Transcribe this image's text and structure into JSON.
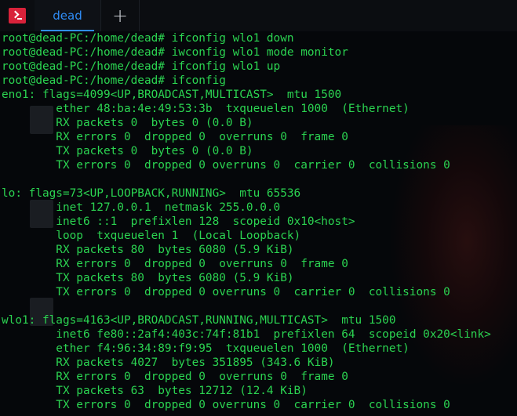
{
  "titlebar": {
    "app_icon": "terminal-icon",
    "tab_label": "dead",
    "add_tab_icon": "plus-icon"
  },
  "colors": {
    "background": "#05070a",
    "text": "#2bd451",
    "tab_accent": "#2f8df7",
    "app_icon": "#d9223a"
  },
  "terminal": {
    "lines": [
      "root@dead-PC:/home/dead# ifconfig wlo1 down",
      "root@dead-PC:/home/dead# iwconfig wlo1 mode monitor",
      "root@dead-PC:/home/dead# ifconfig wlo1 up",
      "root@dead-PC:/home/dead# ifconfig",
      "eno1: flags=4099<UP,BROADCAST,MULTICAST>  mtu 1500",
      "        ether 48:ba:4e:49:53:3b  txqueuelen 1000  (Ethernet)",
      "        RX packets 0  bytes 0 (0.0 B)",
      "        RX errors 0  dropped 0  overruns 0  frame 0",
      "        TX packets 0  bytes 0 (0.0 B)",
      "        TX errors 0  dropped 0 overruns 0  carrier 0  collisions 0",
      "",
      "lo: flags=73<UP,LOOPBACK,RUNNING>  mtu 65536",
      "        inet 127.0.0.1  netmask 255.0.0.0",
      "        inet6 ::1  prefixlen 128  scopeid 0x10<host>",
      "        loop  txqueuelen 1  (Local Loopback)",
      "        RX packets 80  bytes 6080 (5.9 KiB)",
      "        RX errors 0  dropped 0  overruns 0  frame 0",
      "        TX packets 80  bytes 6080 (5.9 KiB)",
      "        TX errors 0  dropped 0 overruns 0  carrier 0  collisions 0",
      "",
      "wlo1: flags=4163<UP,BROADCAST,RUNNING,MULTICAST>  mtu 1500",
      "        inet6 fe80::2af4:403c:74f:81b1  prefixlen 64  scopeid 0x20<link>",
      "        ether f4:96:34:89:f9:95  txqueuelen 1000  (Ethernet)",
      "        RX packets 4027  bytes 351895 (343.6 KiB)",
      "        RX errors 0  dropped 0  overruns 0  frame 0",
      "        TX packets 63  bytes 12712 (12.4 KiB)",
      "        TX errors 0  dropped 0 overruns 0  carrier 0  collisions 0"
    ]
  }
}
